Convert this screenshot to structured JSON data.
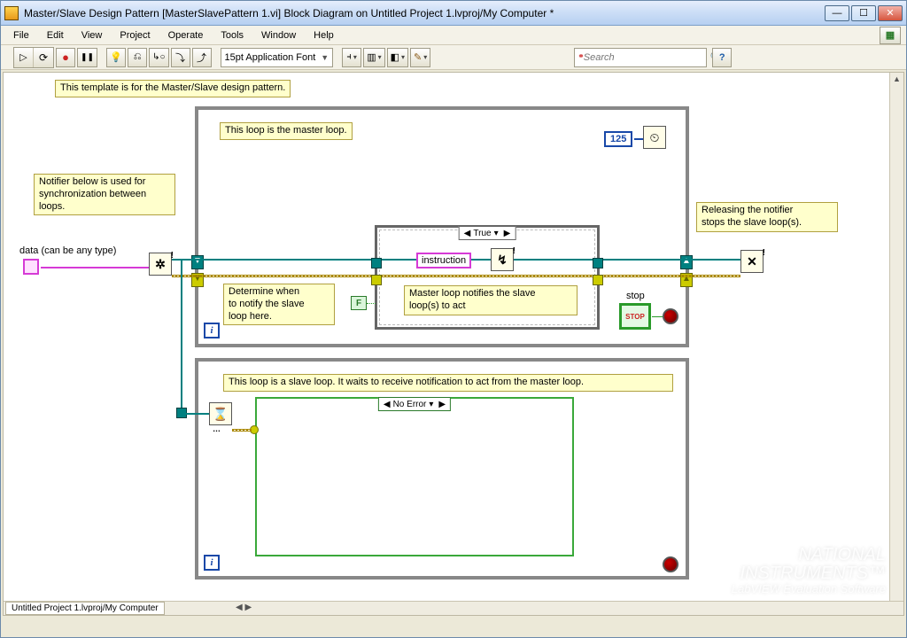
{
  "window": {
    "title": "Master/Slave Design Pattern [MasterSlavePattern 1.vi] Block Diagram on Untitled Project 1.lvproj/My Computer *",
    "tab": "Untitled Project 1.lvproj/My Computer"
  },
  "menu": {
    "file": "File",
    "edit": "Edit",
    "view": "View",
    "project": "Project",
    "operate": "Operate",
    "tools": "Tools",
    "window": "Window",
    "help": "Help"
  },
  "toolbar": {
    "font": "15pt Application Font",
    "search_placeholder": "Search"
  },
  "comments": {
    "top": "This template is for the Master/Slave design pattern.",
    "notifier": "Notifier below is used for\nsynchronization between\nloops.",
    "master": "This loop is the master loop.",
    "determine": "Determine when\nto notify the slave\nloop here.",
    "master_notify": "Master loop notifies the slave\nloop(s) to act",
    "release": "Releasing the notifier\nstops the slave loop(s).",
    "slave": "This loop is a slave loop. It waits to receive notification to act from the master loop."
  },
  "labels": {
    "data": "data (can be any type)",
    "instruction": "instruction",
    "stop": "stop"
  },
  "constants": {
    "wait_ms": "125",
    "bool_false": "F",
    "case_true": "True",
    "case_noerror": "No Error"
  },
  "watermark": {
    "brand": "NATIONAL",
    "brand2": "INSTRUMENTS",
    "edition": "LabVIEW  Evaluation Software"
  }
}
